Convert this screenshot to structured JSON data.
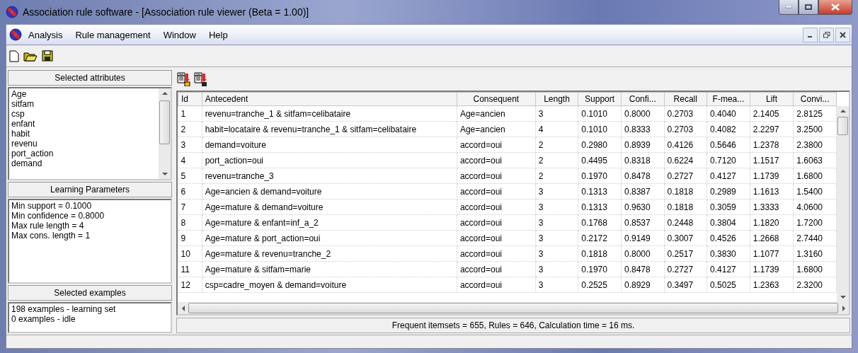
{
  "window": {
    "title": "Association rule software - [Association rule viewer (Beta = 1.00)]"
  },
  "menu": {
    "items": [
      "Analysis",
      "Rule management",
      "Window",
      "Help"
    ]
  },
  "attributes_panel": {
    "title": "Selected attributes",
    "items": [
      "Age",
      "sitfam",
      "csp",
      "enfant",
      "habit",
      "revenu",
      "port_action",
      "demand"
    ]
  },
  "parameters_panel": {
    "title": "Learning Parameters",
    "lines": [
      "Min support = 0.1000",
      "Min confidence = 0.8000",
      "Max rule length = 4",
      "Max cons. length = 1"
    ]
  },
  "examples_panel": {
    "title": "Selected examples",
    "lines": [
      "198 examples - learning set",
      "0 examples - idle"
    ]
  },
  "table": {
    "columns": [
      "Id",
      "Antecedent",
      "Consequent",
      "Length",
      "Support",
      "Confi...",
      "Recall",
      "F-mea...",
      "Lift",
      "Convi..."
    ],
    "rows": [
      [
        "1",
        "revenu=tranche_1 & sitfam=celibataire",
        "Age=ancien",
        "3",
        "0.1010",
        "0.8000",
        "0.2703",
        "0.4040",
        "2.1405",
        "2.8125"
      ],
      [
        "2",
        "habit=locataire & revenu=tranche_1 & sitfam=celibataire",
        "Age=ancien",
        "4",
        "0.1010",
        "0.8333",
        "0.2703",
        "0.4082",
        "2.2297",
        "3.2500"
      ],
      [
        "3",
        "demand=voiture",
        "accord=oui",
        "2",
        "0.2980",
        "0.8939",
        "0.4126",
        "0.5646",
        "1.2378",
        "2.3800"
      ],
      [
        "4",
        "port_action=oui",
        "accord=oui",
        "2",
        "0.4495",
        "0.8318",
        "0.6224",
        "0.7120",
        "1.1517",
        "1.6063"
      ],
      [
        "5",
        "revenu=tranche_3",
        "accord=oui",
        "2",
        "0.1970",
        "0.8478",
        "0.2727",
        "0.4127",
        "1.1739",
        "1.6800"
      ],
      [
        "6",
        "Age=ancien & demand=voiture",
        "accord=oui",
        "3",
        "0.1313",
        "0.8387",
        "0.1818",
        "0.2989",
        "1.1613",
        "1.5400"
      ],
      [
        "7",
        "Age=mature & demand=voiture",
        "accord=oui",
        "3",
        "0.1313",
        "0.9630",
        "0.1818",
        "0.3059",
        "1.3333",
        "4.0600"
      ],
      [
        "8",
        "Age=mature & enfant=inf_a_2",
        "accord=oui",
        "3",
        "0.1768",
        "0.8537",
        "0.2448",
        "0.3804",
        "1.1820",
        "1.7200"
      ],
      [
        "9",
        "Age=mature & port_action=oui",
        "accord=oui",
        "3",
        "0.2172",
        "0.9149",
        "0.3007",
        "0.4526",
        "1.2668",
        "2.7440"
      ],
      [
        "10",
        "Age=mature & revenu=tranche_2",
        "accord=oui",
        "3",
        "0.1818",
        "0.8000",
        "0.2517",
        "0.3830",
        "1.1077",
        "1.3160"
      ],
      [
        "11",
        "Age=mature & sitfam=marie",
        "accord=oui",
        "3",
        "0.1970",
        "0.8478",
        "0.2727",
        "0.4127",
        "1.1739",
        "1.6800"
      ],
      [
        "12",
        "csp=cadre_moyen & demand=voiture",
        "accord=oui",
        "3",
        "0.2525",
        "0.8929",
        "0.3497",
        "0.5025",
        "1.2363",
        "2.3200"
      ]
    ]
  },
  "status": "Frequent itemsets = 655, Rules = 646, Calculation time = 16 ms."
}
